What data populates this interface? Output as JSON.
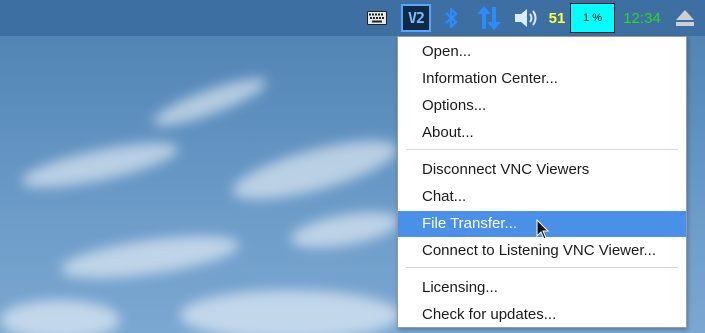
{
  "taskbar": {
    "icons": {
      "keyboard": "keyboard-icon",
      "vnc": "vnc-server-icon",
      "bluetooth": "bluetooth-icon",
      "network": "network-arrows-icon",
      "volume": "volume-icon",
      "eject": "eject-icon"
    },
    "vnc_label": "V2",
    "temperature": "51",
    "cpu_usage": "1 %",
    "clock": "12:34",
    "colors": {
      "taskbar_bg": "#3d6fa3",
      "temperature": "#ffff3a",
      "cpu_bg": "#00ffff",
      "clock": "#22dd22",
      "accent": "#4a90e8"
    }
  },
  "menu": {
    "items": [
      {
        "label": "Open..."
      },
      {
        "label": "Information Center..."
      },
      {
        "label": "Options..."
      },
      {
        "label": "About..."
      },
      {
        "label": "Disconnect VNC Viewers"
      },
      {
        "label": "Chat..."
      },
      {
        "label": "File Transfer...",
        "highlighted": true
      },
      {
        "label": "Connect to Listening VNC Viewer..."
      },
      {
        "label": "Licensing..."
      },
      {
        "label": "Check for updates..."
      }
    ]
  }
}
